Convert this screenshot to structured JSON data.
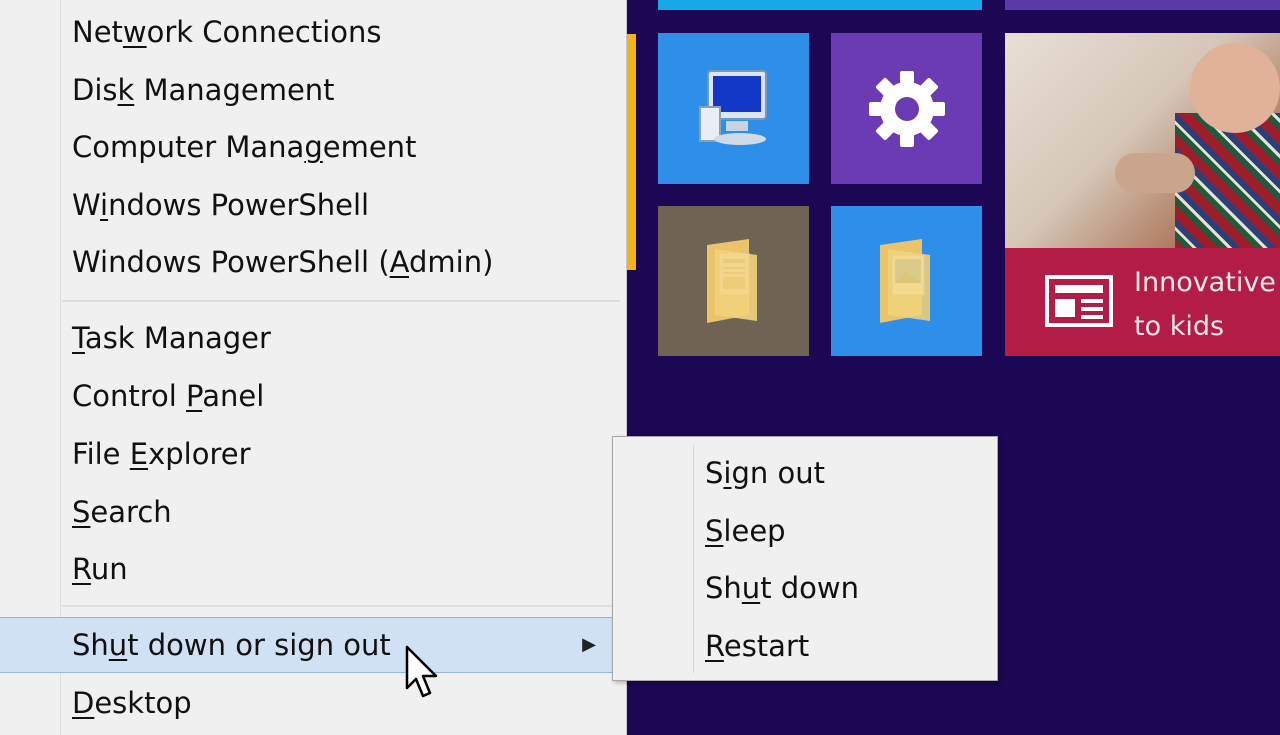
{
  "colors": {
    "start_background": "#1b0753",
    "menu_background": "#f0f0f0",
    "highlight": "#cfe1f3",
    "tile_blue": "#2e8fe8",
    "tile_purple": "#6a3bb3",
    "tile_taupe": "#6f6454",
    "news_red": "#b31c45"
  },
  "context_menu": {
    "items_group1": [
      {
        "pre": "Net",
        "accel": "w",
        "post": "ork Connections"
      },
      {
        "pre": "Dis",
        "accel": "k",
        "post": " Management"
      },
      {
        "pre": "Computer Mana",
        "accel": "g",
        "post": "ement"
      },
      {
        "pre": "W",
        "accel": "i",
        "post": "ndows PowerShell"
      },
      {
        "pre": "Windows PowerShell (",
        "accel": "A",
        "post": "dmin)"
      }
    ],
    "items_group2": [
      {
        "pre": "",
        "accel": "T",
        "post": "ask Manager"
      },
      {
        "pre": "Control ",
        "accel": "P",
        "post": "anel"
      },
      {
        "pre": "File ",
        "accel": "E",
        "post": "xplorer"
      },
      {
        "pre": "",
        "accel": "S",
        "post": "earch"
      },
      {
        "pre": "",
        "accel": "R",
        "post": "un"
      }
    ],
    "shutdown": {
      "pre": "Sh",
      "accel": "u",
      "post": "t down or sign out",
      "arrow": "▶"
    },
    "desktop": {
      "pre": "",
      "accel": "D",
      "post": "esktop"
    }
  },
  "submenu": {
    "items": [
      {
        "pre": "S",
        "accel": "i",
        "post": "gn out"
      },
      {
        "pre": "",
        "accel": "S",
        "post": "leep"
      },
      {
        "pre": "Sh",
        "accel": "u",
        "post": "t down"
      },
      {
        "pre": "",
        "accel": "R",
        "post": "estart"
      }
    ]
  },
  "tiles": {
    "news_headline_line1": "Innovative",
    "news_headline_line2": "to kids"
  },
  "icons": {
    "computer": "computer-icon",
    "settings": "gear-icon",
    "folder": "folder-icon",
    "news": "news-icon",
    "cursor": "mouse-pointer-icon"
  }
}
